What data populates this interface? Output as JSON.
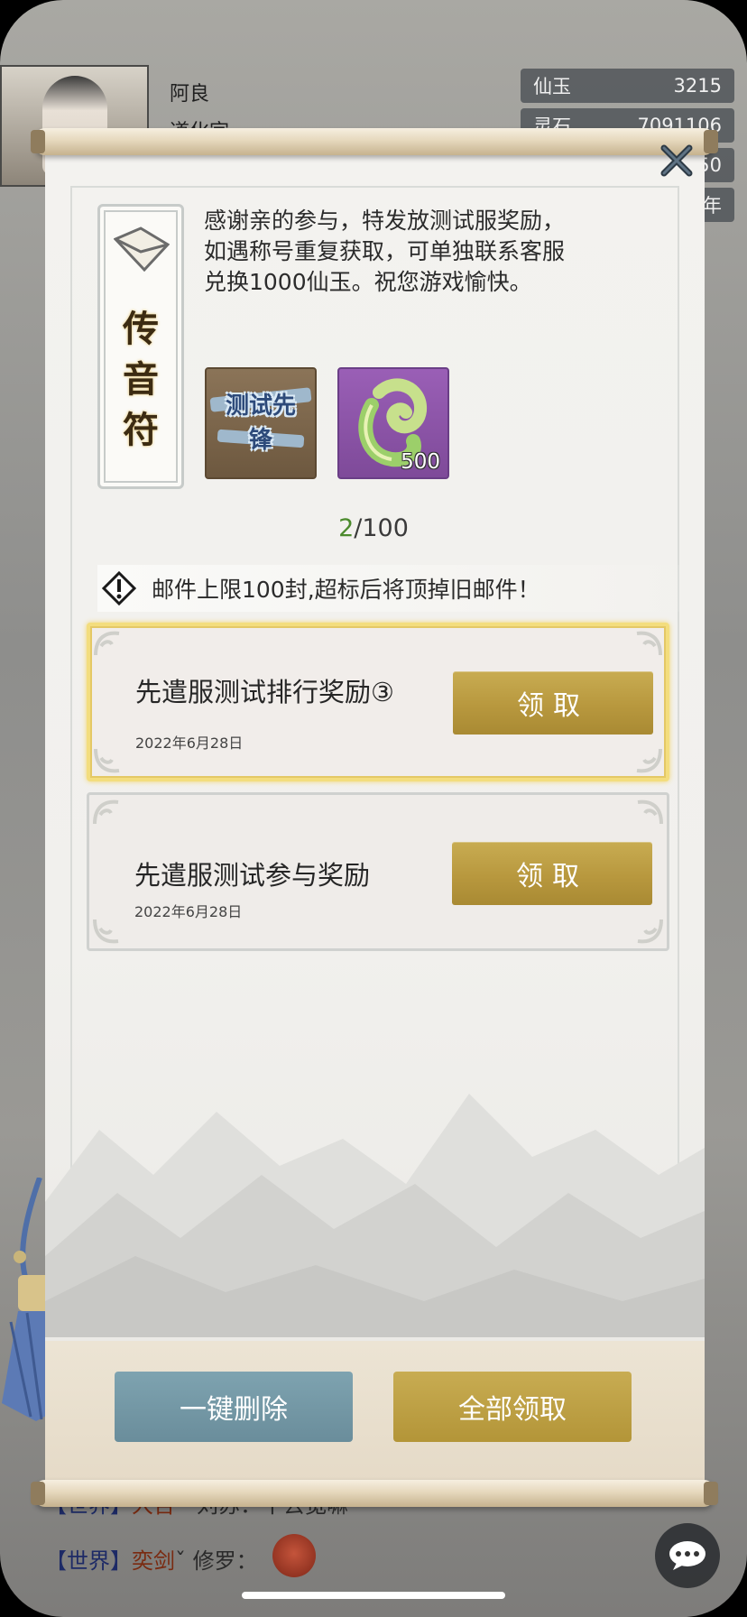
{
  "background": {
    "player_name": "阿良",
    "player_sub": "道化宗",
    "resources": [
      {
        "label": "仙玉",
        "value": "3215"
      },
      {
        "label": "灵石",
        "value": "7091106"
      },
      {
        "label": "",
        "value": "50"
      },
      {
        "label": "",
        "value": "年"
      }
    ],
    "chat": [
      {
        "channel": "【世界】",
        "sender": "大吉",
        "text": "・刘苏：干去宽嘛"
      },
      {
        "channel": "【世界】",
        "sender": "奕剑",
        "text": "ˇ 修罗："
      }
    ]
  },
  "mail_panel": {
    "close_icon": "close-x-icon",
    "card_title_lines": [
      "传",
      "音",
      "符"
    ],
    "message_lines": [
      "感谢亲的参与，特发放测试服奖励，",
      "如遇称号重复获取，可单独联系客服",
      "兑换1000仙玉。祝您游戏愉快。"
    ],
    "rewards": [
      {
        "name": "测试先锋",
        "icon": "title-badge-icon",
        "qty": ""
      },
      {
        "name": "",
        "icon": "jade-dragon-icon",
        "qty": "500"
      }
    ],
    "mail_count": {
      "current": "2",
      "separator": "/",
      "max": "100"
    },
    "warning": "邮件上限100封,超标后将顶掉旧邮件！",
    "mails": [
      {
        "title": "先遣服测试排行奖励③",
        "date": "2022年6月28日",
        "claim_label": "领取",
        "selected": true
      },
      {
        "title": "先遣服测试参与奖励",
        "date": "2022年6月28日",
        "claim_label": "领取",
        "selected": false
      }
    ],
    "buttons": {
      "delete_all": "一键删除",
      "claim_all": "全部领取"
    }
  },
  "colors": {
    "gold_button": "#b8983e",
    "blue_button": "#6f93a1",
    "count_current": "#4b8a2c",
    "selected_border": "#f3dd7e"
  }
}
